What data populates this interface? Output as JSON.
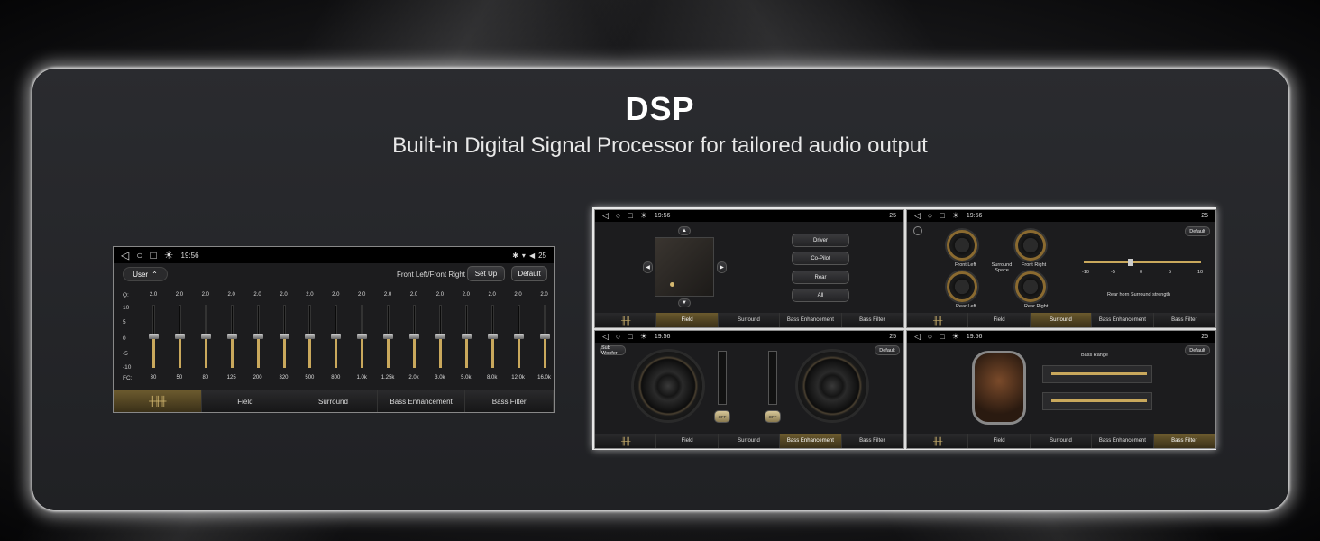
{
  "header": {
    "title": "DSP",
    "subtitle": "Built-in Digital Signal Processor for tailored audio output"
  },
  "status": {
    "time": "19:56",
    "volume": "25"
  },
  "tabs": [
    "Field",
    "Surround",
    "Bass Enhancement",
    "Bass Filter"
  ],
  "eq": {
    "preset": "User",
    "channel": "Front Left/Front Right",
    "setup_label": "Set Up",
    "default_label": "Default",
    "q_label": "Q:",
    "fc_label": "FC:",
    "db_scale": [
      "10",
      "5",
      "0",
      "-5",
      "-10"
    ],
    "q_values": [
      "2.0",
      "2.0",
      "2.0",
      "2.0",
      "2.0",
      "2.0",
      "2.0",
      "2.0",
      "2.0",
      "2.0",
      "2.0",
      "2.0",
      "2.0",
      "2.0",
      "2.0",
      "2.0"
    ],
    "frequencies": [
      "30",
      "50",
      "80",
      "125",
      "200",
      "320",
      "500",
      "800",
      "1.0k",
      "1.25k",
      "2.0k",
      "3.0k",
      "5.0k",
      "8.0k",
      "12.0k",
      "16.0k"
    ]
  },
  "field": {
    "positions": [
      "Driver",
      "Co-Pilot",
      "Rear",
      "All"
    ]
  },
  "surround": {
    "default_label": "Default",
    "center_label": "Surround Space",
    "dials": [
      "Front Left",
      "Front Right",
      "Rear Left",
      "Rear Right"
    ],
    "strength_label": "Rear horn Surround strength",
    "scale": [
      "-10",
      "-5",
      "0",
      "5",
      "10"
    ]
  },
  "bass_enh": {
    "subwoofer_label": "Sub Woofer",
    "default_label": "Default",
    "switch_left": "OFF",
    "switch_right": "OFF"
  },
  "bass_filter": {
    "default_label": "Default",
    "range_label": "Bass Range"
  }
}
